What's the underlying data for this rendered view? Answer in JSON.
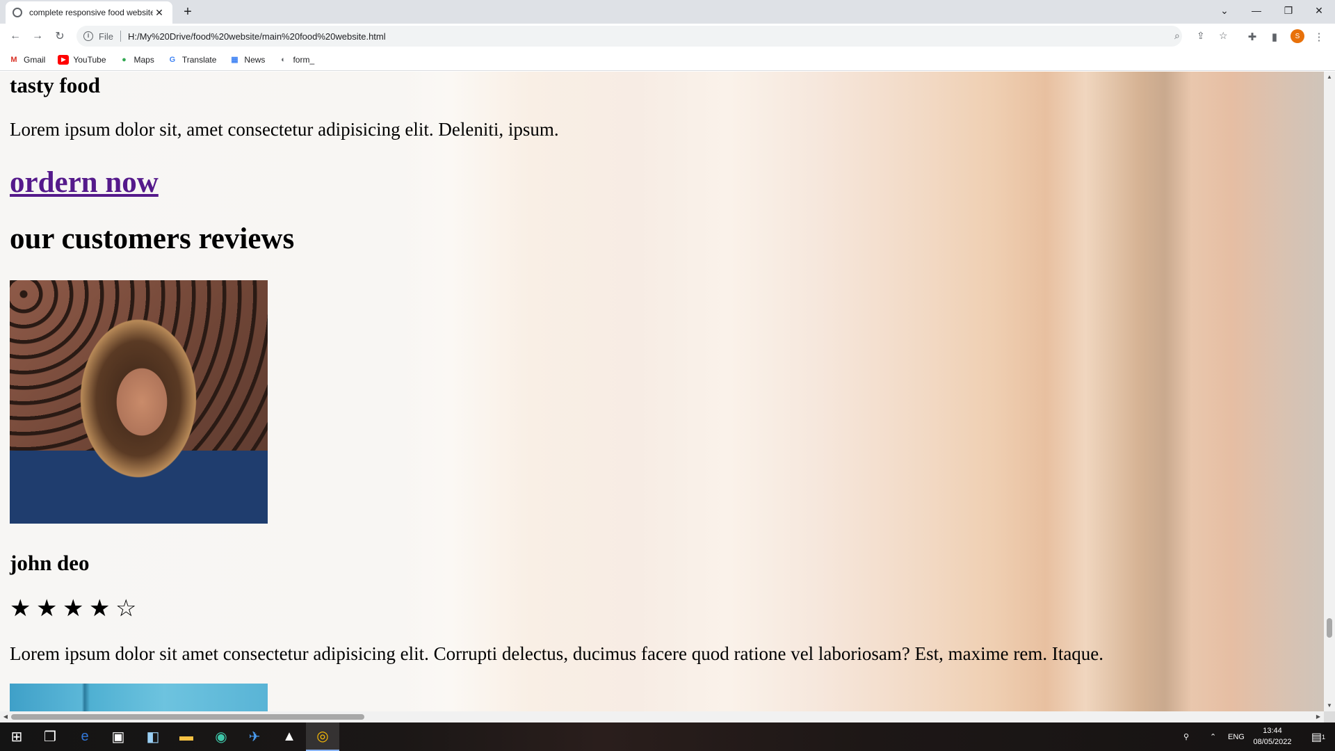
{
  "browser": {
    "tab_title": "complete responsive food website",
    "new_tab": "+",
    "url_scheme": "File",
    "url": "H:/My%20Drive/food%20website/main%20food%20website.html",
    "profile_initial": "S",
    "bookmarks": [
      {
        "label": "Gmail",
        "icon": "gmail-icon",
        "color": "#d93025",
        "glyph": "M"
      },
      {
        "label": "YouTube",
        "icon": "youtube-icon",
        "color": "#ff0000",
        "glyph": "▶"
      },
      {
        "label": "Maps",
        "icon": "maps-icon",
        "color": "#34a853",
        "glyph": "●"
      },
      {
        "label": "Translate",
        "icon": "translate-icon",
        "color": "#4285f4",
        "glyph": "G"
      },
      {
        "label": "News",
        "icon": "news-icon",
        "color": "#4285f4",
        "glyph": "▦"
      },
      {
        "label": "form_",
        "icon": "globe-icon",
        "color": "#5f6368",
        "glyph": "◐"
      }
    ]
  },
  "page": {
    "tasty_heading": "tasty food",
    "tasty_text": "Lorem ipsum dolor sit, amet consectetur adipisicing elit. Deleniti, ipsum.",
    "order_link": "ordern now",
    "reviews_heading": "our customers reviews",
    "reviewer_name": "john deo",
    "rating": 4,
    "rating_max": 5,
    "review_text": "Lorem ipsum dolor sit amet consectetur adipisicing elit. Corrupti delectus, ducimus facere quod ratione vel laboriosam? Est, maxime rem. Itaque.",
    "link_color": "#551a8b"
  },
  "taskbar": {
    "language": "ENG",
    "time": "13:44",
    "date": "08/05/2022",
    "notification_count": "1"
  }
}
